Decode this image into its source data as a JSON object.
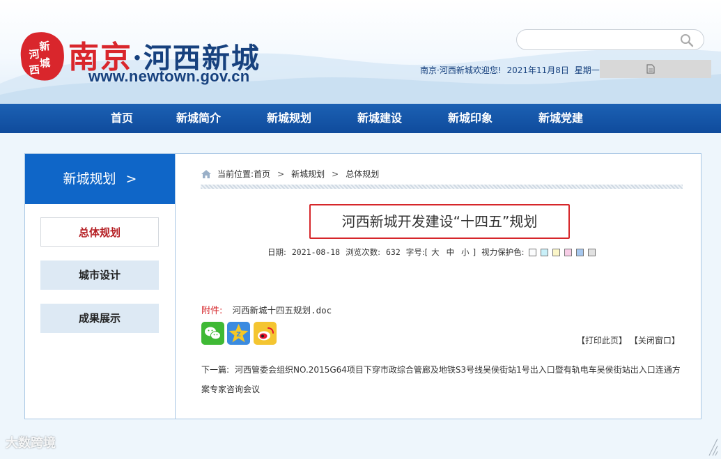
{
  "header": {
    "seal_chars": [
      "新",
      "河",
      "城",
      "西"
    ],
    "title_nanjing": "南京",
    "title_dot": "·",
    "title_rest": "河西新城",
    "url": "www.newtown.gov.cn",
    "search_placeholder": "",
    "welcome": "南京·河西新城欢迎您!",
    "date": "2021年11月8日",
    "weekday": "星期一"
  },
  "nav": {
    "items": [
      "首页",
      "新城简介",
      "新城规划",
      "新城建设",
      "新城印象",
      "新城党建"
    ]
  },
  "sidebar": {
    "heading": "新城规划",
    "heading_arrow": ">",
    "items": [
      {
        "label": "总体规划",
        "active": true
      },
      {
        "label": "城市设计",
        "active": false
      },
      {
        "label": "成果展示",
        "active": false
      }
    ]
  },
  "breadcrumb": {
    "prefix": "当前位置:",
    "items": [
      "首页",
      "新城规划",
      "总体规划"
    ],
    "separator": ">"
  },
  "article": {
    "title": "河西新城开发建设“十四五”规划",
    "date_label": "日期:",
    "date": "2021-08-18",
    "views_label": "浏览次数:",
    "views": "632",
    "font_label": "字号:",
    "font_open": "[",
    "font_sizes": [
      "大",
      "中",
      "小"
    ],
    "font_close": "]",
    "eye_label": "视力保护色:",
    "eye_colors": [
      "#fbfcfd",
      "#c9f0f9",
      "#fbf6c8",
      "#f7cde6",
      "#a6c7ee",
      "#e1e1e1"
    ],
    "attachment_label": "附件:",
    "attachment_file_cjk": "河西新城十四五规划",
    "attachment_file_ext": ".doc",
    "share_icons": [
      "wechat-icon",
      "qzone-icon",
      "weibo-icon"
    ],
    "print_label": "【打印此页】",
    "close_label": "【关闭窗口】",
    "next_label": "下一篇:",
    "next_title": "河西管委会组织NO.2015G64项目下穿市政综合管廊及地铁S3号线吴侯街站1号出入口暨有轨电车吴侯街站出入口连通方案专家咨询会议"
  },
  "watermark": "大数跨境",
  "colors": {
    "brand_blue": "#0f66c8",
    "nav_blue": "#1c61b4",
    "accent_red": "#d6262a"
  }
}
